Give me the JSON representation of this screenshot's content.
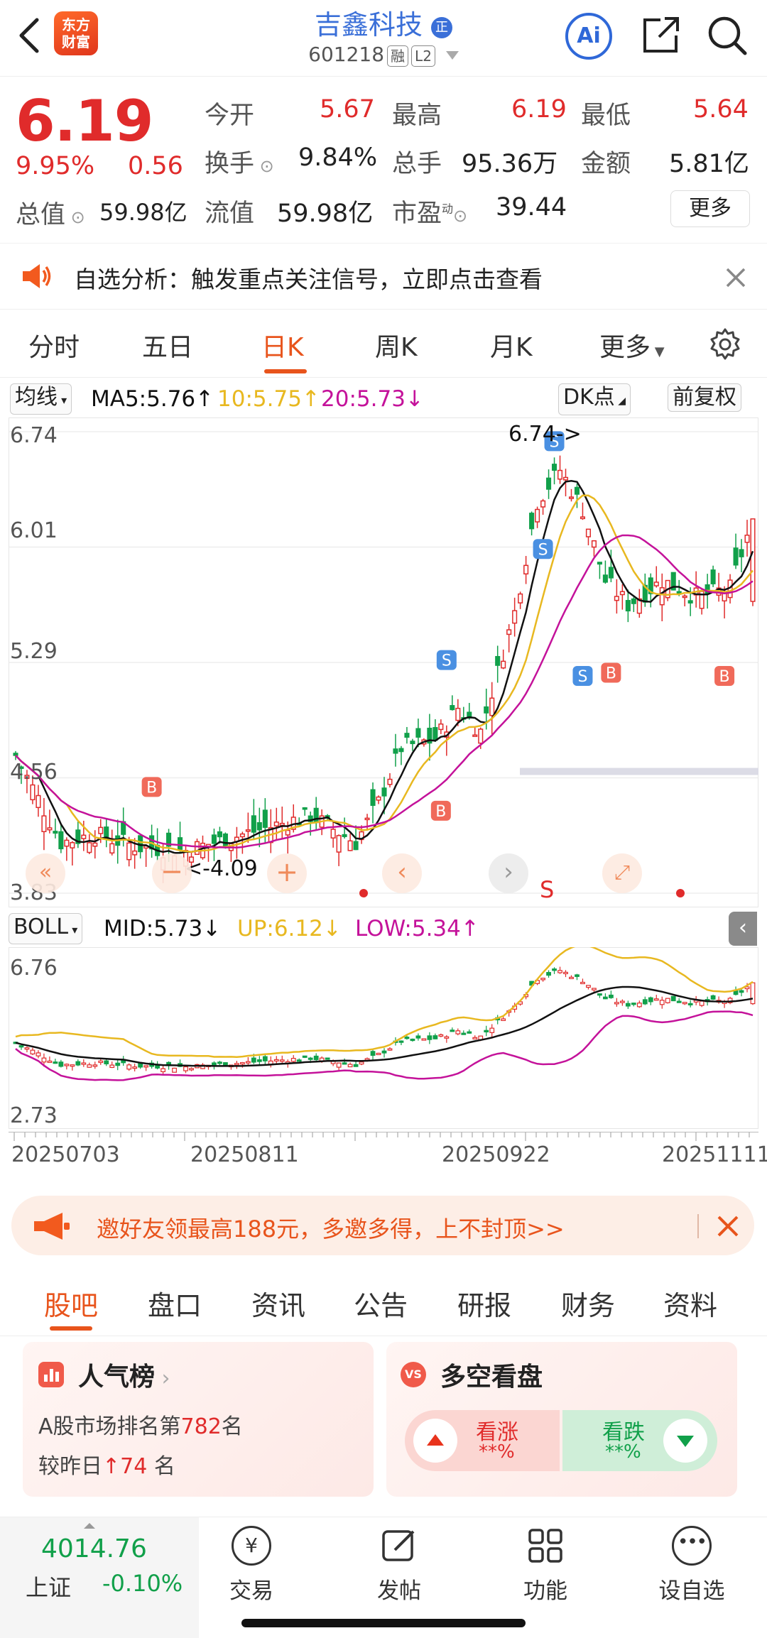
{
  "header": {
    "logo_text": "东方财富",
    "stock_name": "吉鑫科技",
    "badge": "正",
    "code": "601218",
    "tag_rong": "融",
    "tag_level": "L2"
  },
  "quote": {
    "price": "6.19",
    "change_pct": "9.95%",
    "change_amt": "0.56",
    "open_label": "今开",
    "open": "5.67",
    "high_label": "最高",
    "high": "6.19",
    "low_label": "最低",
    "low": "5.64",
    "turnover_label": "换手",
    "turnover": "9.84%",
    "volume_label": "总手",
    "volume": "95.36万",
    "amount_label": "金额",
    "amount": "5.81亿",
    "mktcap_label": "总值",
    "mktcap": "59.98亿",
    "float_label": "流值",
    "float": "59.98亿",
    "pe_label": "市盈",
    "pe_sup": "动",
    "pe": "39.44",
    "more": "更多"
  },
  "signal": {
    "text": "自选分析：触发重点关注信号，立即点击查看"
  },
  "ktabs": [
    "分时",
    "五日",
    "日K",
    "周K",
    "月K",
    "更多"
  ],
  "ma": {
    "selector": "均线",
    "ma5": "MA5:5.76",
    "ma10": "10:5.75",
    "ma20": "20:5.73",
    "dk": "DK点",
    "adjust": "前复权"
  },
  "chart_main": {
    "y_labels": [
      "6.74",
      "6.01",
      "5.29",
      "4.56",
      "3.83"
    ],
    "max_label": "6.74->",
    "min_label": "<-4.09",
    "colors": {
      "up": "#e02b2b",
      "down": "#11a04a",
      "ma5": "#111111",
      "ma10": "#e8b820",
      "ma20": "#c4129a"
    }
  },
  "boll": {
    "selector": "BOLL",
    "mid": "MID:5.73",
    "up": "UP:6.12",
    "low": "LOW:5.34",
    "y_labels": [
      "6.76",
      "2.73"
    ]
  },
  "x_dates": [
    "20250703",
    "20250811",
    "20250922",
    "20251111"
  ],
  "invite": {
    "text": "邀好友领最高188元，多邀多得，上不封顶>>"
  },
  "btabs": [
    "股吧",
    "盘口",
    "资讯",
    "公告",
    "研报",
    "财务",
    "资料"
  ],
  "popularity": {
    "title": "人气榜",
    "rank_prefix": "A股市场排名第",
    "rank": "782",
    "rank_suffix": "名",
    "change_prefix": "较昨日",
    "change": "74",
    "change_suffix": "名"
  },
  "longshort": {
    "title": "多空看盘",
    "up_label": "看涨",
    "up_val": "**%",
    "down_label": "看跌",
    "down_val": "**%"
  },
  "bottom": {
    "index_value": "4014.76",
    "index_name": "上证",
    "index_change": "-0.10%",
    "nav": [
      "交易",
      "发帖",
      "功能",
      "设自选"
    ]
  }
}
